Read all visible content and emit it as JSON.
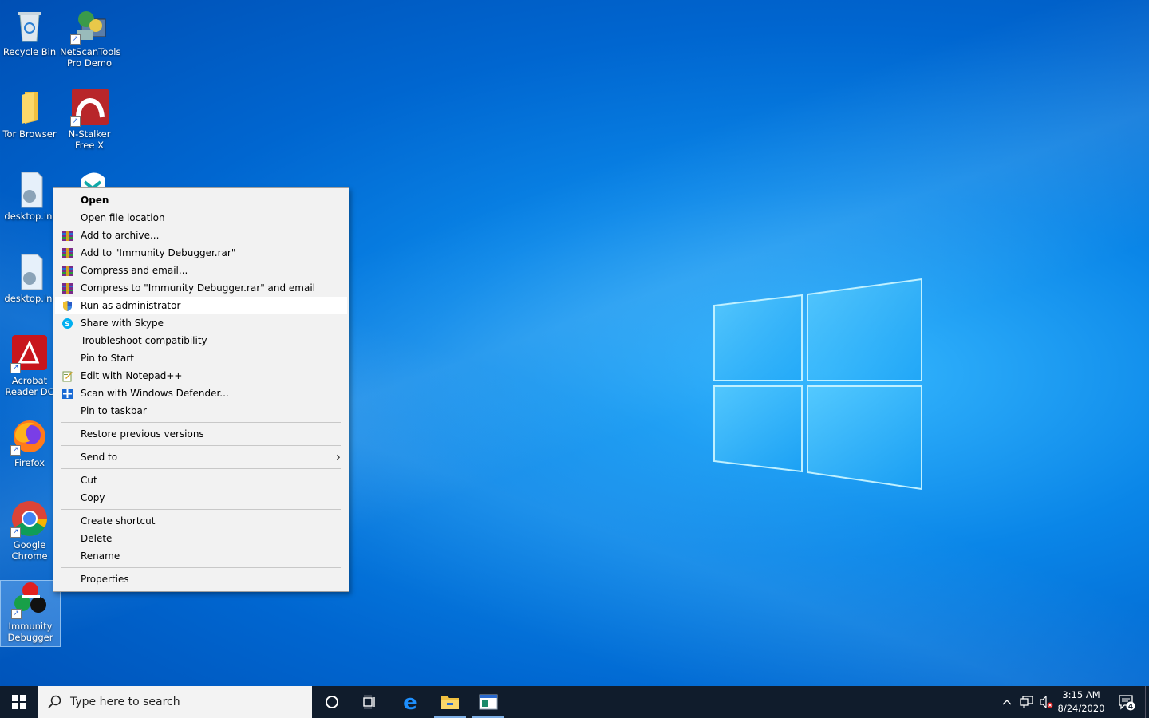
{
  "desktop": {
    "icons": [
      {
        "label": "Recycle Bin"
      },
      {
        "label": "NetScanTools Pro Demo"
      },
      {
        "label": "Tor Browser"
      },
      {
        "label": "N-Stalker Free X"
      },
      {
        "label": "desktop.ini"
      },
      {
        "label": "desktop.ini"
      },
      {
        "label": "Acrobat Reader DC"
      },
      {
        "label": "Firefox"
      },
      {
        "label": "Google Chrome"
      },
      {
        "label": "Immunity Debugger"
      }
    ]
  },
  "context_menu": {
    "items": [
      {
        "label": "Open"
      },
      {
        "label": "Open file location"
      },
      {
        "label": "Add to archive...",
        "icon": "winrar-icon"
      },
      {
        "label": "Add to \"Immunity Debugger.rar\"",
        "icon": "winrar-icon"
      },
      {
        "label": "Compress and email...",
        "icon": "winrar-icon"
      },
      {
        "label": "Compress to \"Immunity Debugger.rar\" and email",
        "icon": "winrar-icon"
      },
      {
        "label": "Run as administrator",
        "icon": "uac-shield-icon"
      },
      {
        "label": "Share with Skype",
        "icon": "skype-icon"
      },
      {
        "label": "Troubleshoot compatibility"
      },
      {
        "label": "Pin to Start"
      },
      {
        "label": "Edit with Notepad++",
        "icon": "notepadpp-icon"
      },
      {
        "label": "Scan with Windows Defender...",
        "icon": "defender-icon"
      },
      {
        "label": "Pin to taskbar"
      },
      {
        "label": "Restore previous versions"
      },
      {
        "label": "Send to"
      },
      {
        "label": "Cut"
      },
      {
        "label": "Copy"
      },
      {
        "label": "Create shortcut"
      },
      {
        "label": "Delete"
      },
      {
        "label": "Rename"
      },
      {
        "label": "Properties"
      }
    ]
  },
  "taskbar": {
    "search_placeholder": "Type here to search",
    "time": "3:15 AM",
    "date": "8/24/2020",
    "notification_count": "4"
  }
}
